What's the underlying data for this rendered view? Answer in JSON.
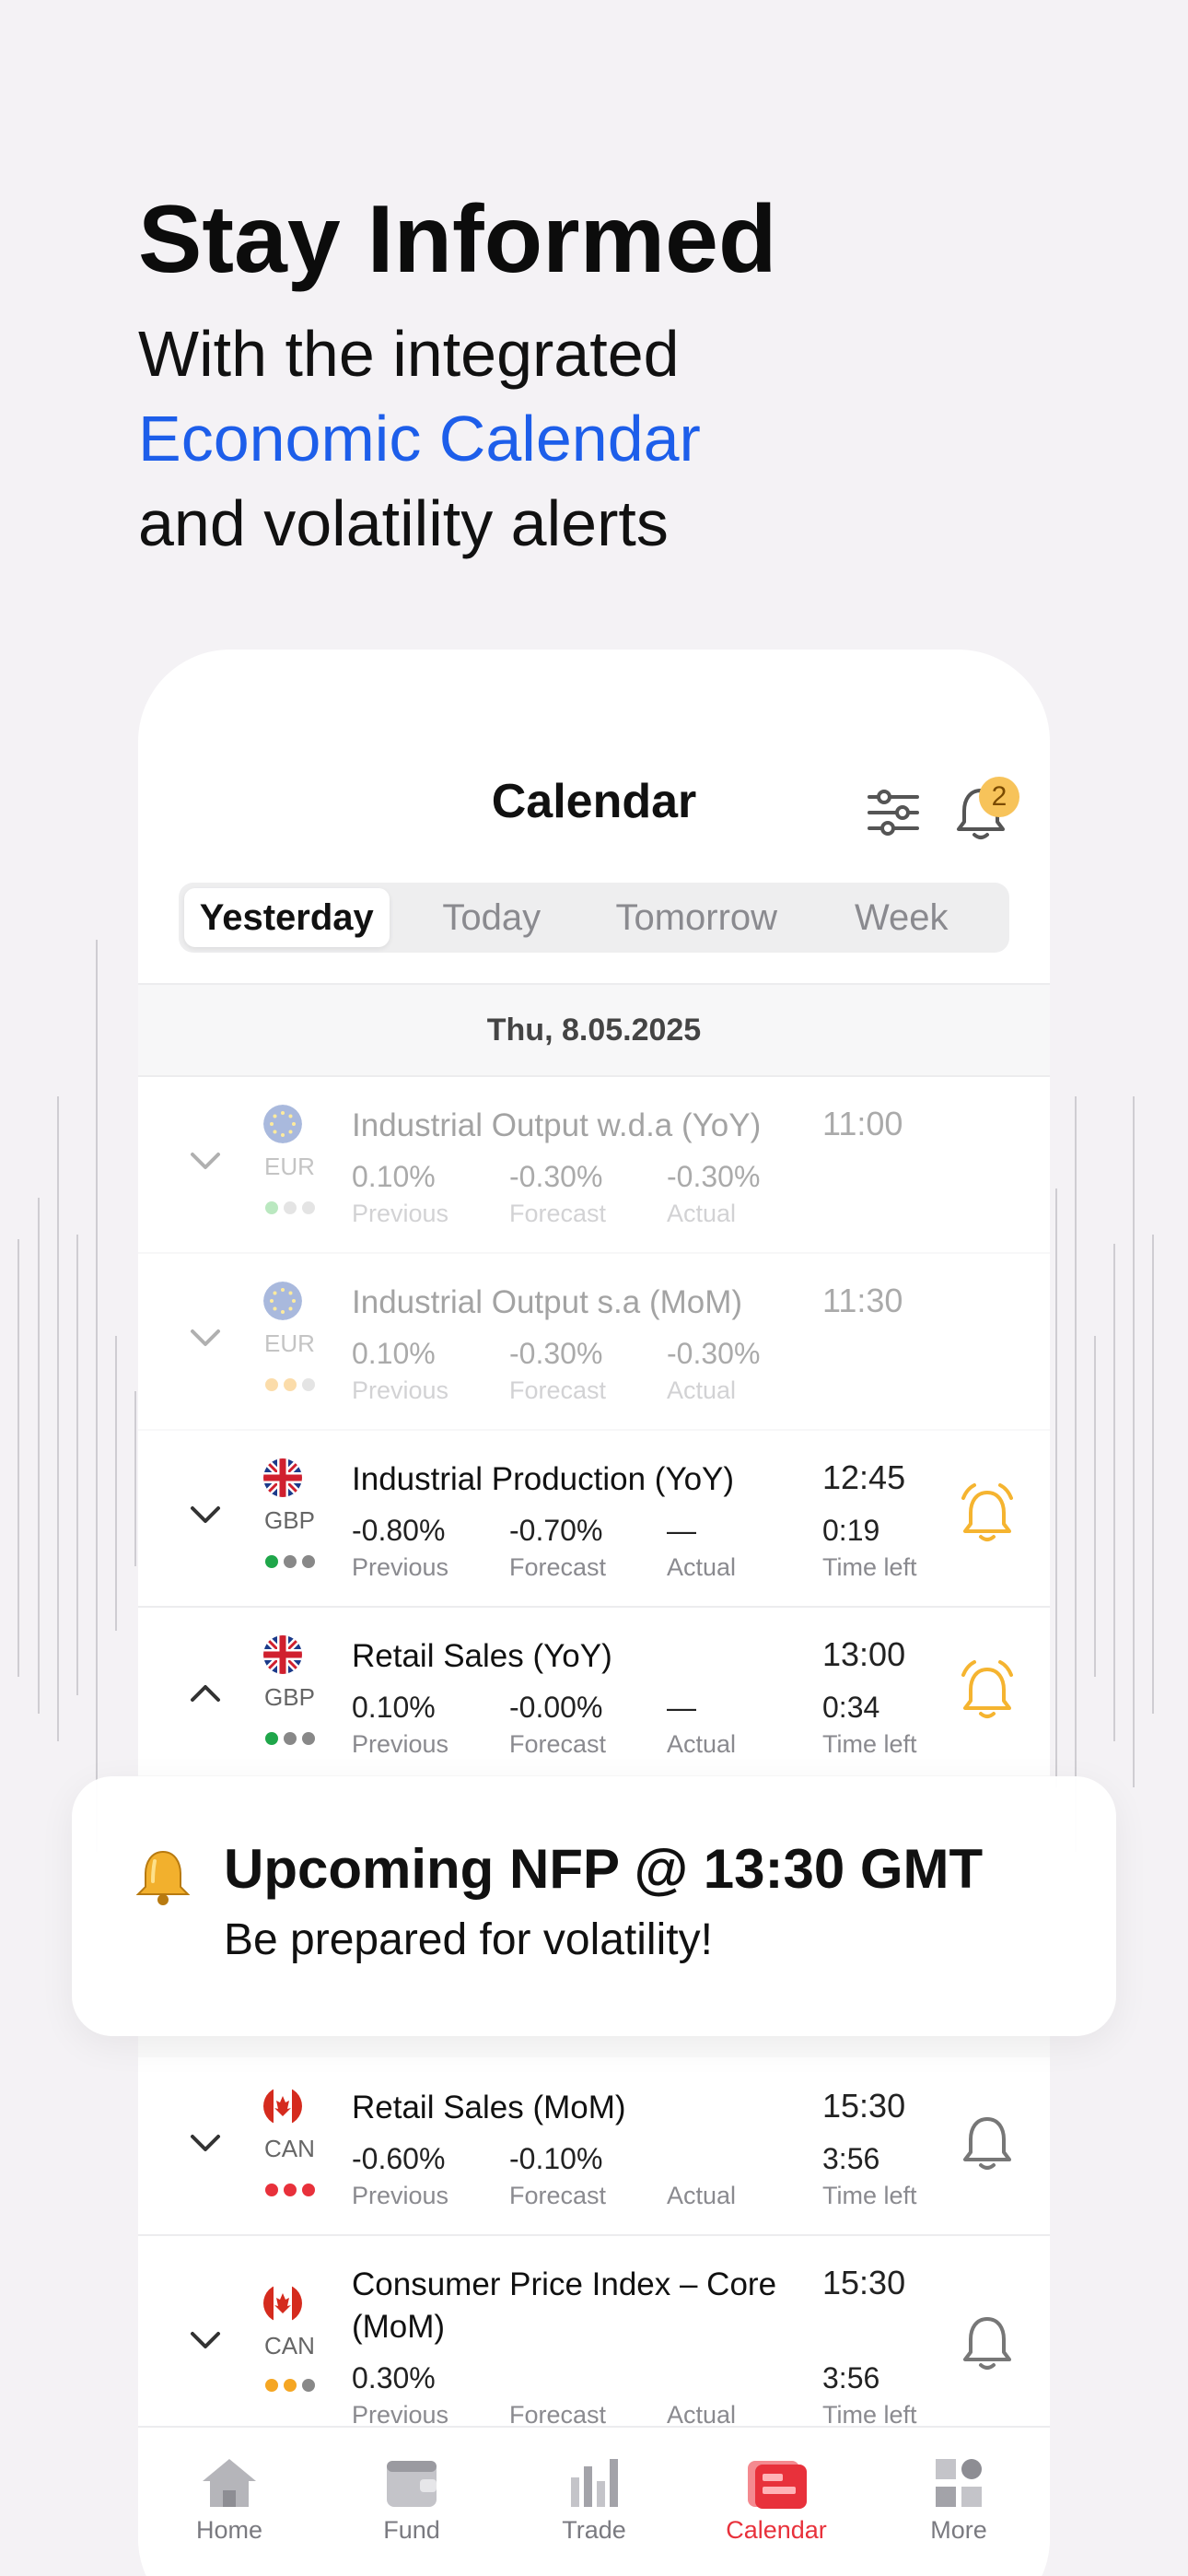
{
  "hero": {
    "title": "Stay Informed",
    "line1": "With the integrated",
    "line2": "Economic Calendar",
    "line3": "and volatility alerts"
  },
  "calendar": {
    "title": "Calendar",
    "badge_count": "2",
    "tabs": [
      "Yesterday",
      "Today",
      "Tomorrow",
      "Week"
    ],
    "date": "Thu, 8.05.2025",
    "labels": {
      "previous": "Previous",
      "forecast": "Forecast",
      "actual": "Actual",
      "time_left": "Time left"
    },
    "events": [
      {
        "currency": "EUR",
        "title": "Industrial Output w.d.a (YoY)",
        "time": "11:00",
        "previous": "0.10%",
        "forecast": "-0.30%",
        "actual": "-0.30%",
        "time_left": "",
        "dots": [
          "#4cc35c",
          "#bbbbbb",
          "#bbbbbb"
        ]
      },
      {
        "currency": "EUR",
        "title": "Industrial Output s.a (MoM)",
        "time": "11:30",
        "previous": "0.10%",
        "forecast": "-0.30%",
        "actual": "-0.30%",
        "time_left": "",
        "dots": [
          "#f5a623",
          "#f5a623",
          "#bbbbbb"
        ]
      },
      {
        "currency": "GBP",
        "title": "Industrial Production (YoY)",
        "time": "12:45",
        "previous": "-0.80%",
        "forecast": "-0.70%",
        "actual": "—",
        "time_left": "0:19",
        "dots": [
          "#1fa64a",
          "#888888",
          "#888888"
        ]
      },
      {
        "currency": "GBP",
        "title": "Retail Sales (YoY)",
        "time": "13:00",
        "previous": "0.10%",
        "forecast": "-0.00%",
        "actual": "—",
        "time_left": "0:34",
        "dots": [
          "#1fa64a",
          "#888888",
          "#888888"
        ]
      },
      {
        "currency": "CAN",
        "title": "Retail Sales (MoM)",
        "time": "15:30",
        "previous": "-0.60%",
        "forecast": "-0.10%",
        "actual": "",
        "time_left": "3:56",
        "dots": [
          "#e8313b",
          "#e8313b",
          "#e8313b"
        ]
      },
      {
        "currency": "CAN",
        "title": "Consumer Price Index – Core (MoM)",
        "time": "15:30",
        "previous": "0.30%",
        "forecast": "",
        "actual": "",
        "time_left": "3:56",
        "dots": [
          "#f5a623",
          "#f5a623",
          "#888888"
        ]
      }
    ]
  },
  "toast": {
    "title": "Upcoming NFP @ 13:30 GMT",
    "subtitle": "Be prepared for volatility!"
  },
  "tabbar": {
    "home": "Home",
    "fund": "Fund",
    "trade": "Trade",
    "calendar": "Calendar",
    "more": "More"
  },
  "colors": {
    "accent_blue": "#1d5eea",
    "accent_red": "#e8313b",
    "alert_orange": "#f5b430"
  }
}
